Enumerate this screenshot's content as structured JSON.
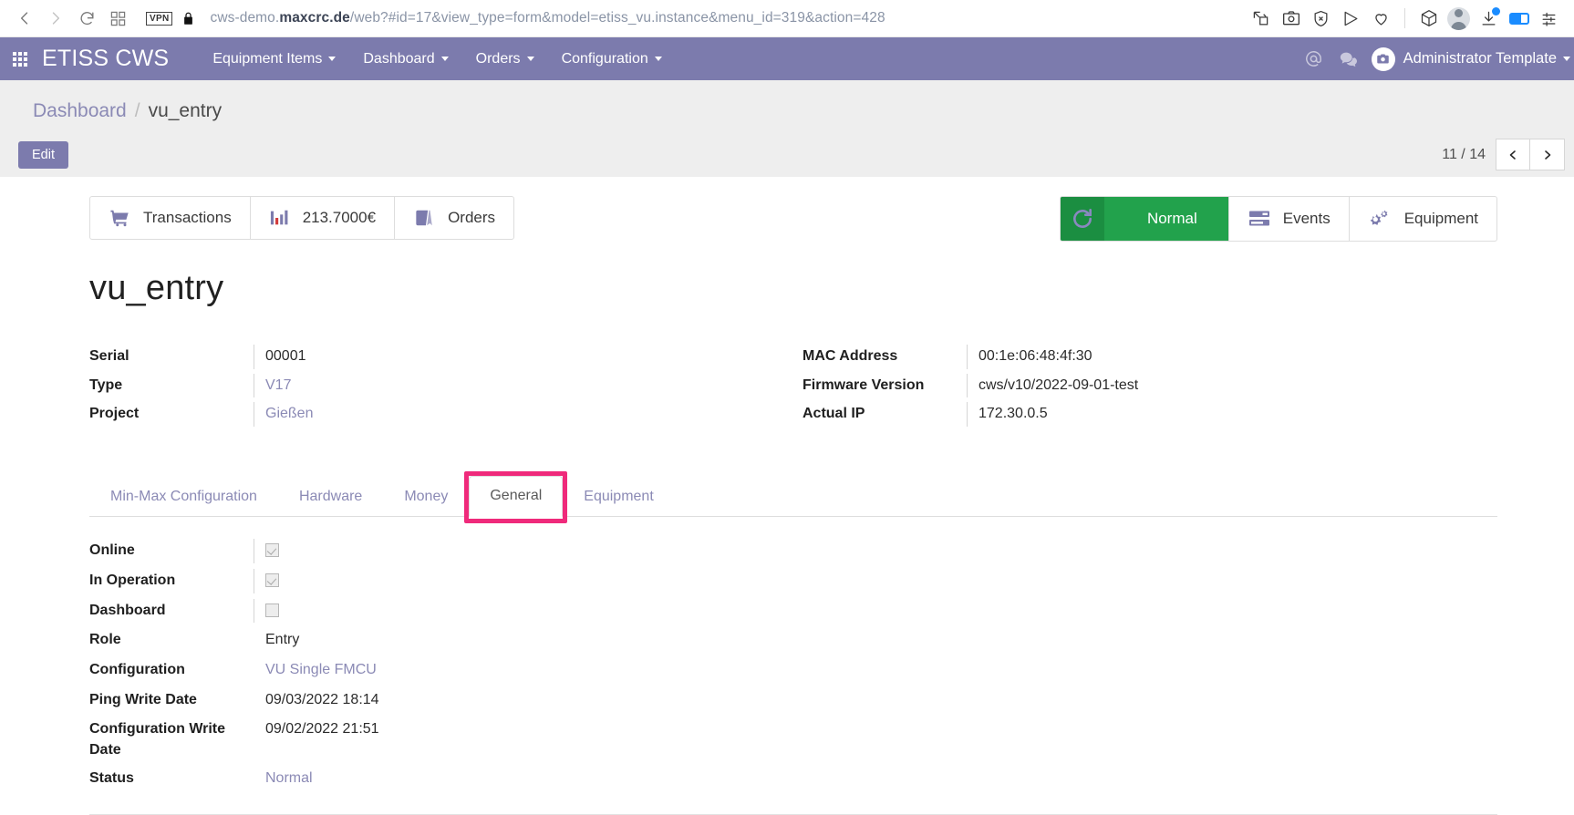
{
  "browser": {
    "back_icon": "back-arrow-icon",
    "forward_icon": "forward-arrow-icon",
    "reload_icon": "reload-icon",
    "tabs_icon": "tab-overview-icon",
    "vpn_badge": "VPN",
    "lock_icon": "lock-icon",
    "url_prefix": "cws-demo.",
    "url_domain": "maxcrc.de",
    "url_suffix": "/web?#id=17&view_type=form&model=etiss_vu.instance&menu_id=319&action=428",
    "url_full": "cws-demo.maxcrc.de/web?#id=17&view_type=form&model=etiss_vu.instance&menu_id=319&action=428",
    "toolbar_icons": [
      "pin-edit-icon",
      "camera-icon",
      "shield-block-icon",
      "send-icon",
      "heart-icon",
      "cube-icon",
      "profile-avatar-icon",
      "download-icon",
      "sidebar-toggle-icon",
      "settings-sliders-icon"
    ]
  },
  "navbar": {
    "apps_icon": "apps-grid-icon",
    "brand": "ETISS CWS",
    "menus": [
      {
        "label": "Equipment Items"
      },
      {
        "label": "Dashboard"
      },
      {
        "label": "Orders"
      },
      {
        "label": "Configuration"
      }
    ],
    "mention_icon": "at-mention-icon",
    "chat_icon": "chat-bubble-icon",
    "user_avatar_icon": "user-camera-avatar-icon",
    "user_name": "Administrator Template"
  },
  "control": {
    "breadcrumb": {
      "parent": "Dashboard",
      "separator": "/",
      "current": "vu_entry"
    },
    "edit_label": "Edit",
    "pager_count": "11 / 14",
    "prev_icon": "chevron-left-icon",
    "next_icon": "chevron-right-icon"
  },
  "stat_buttons_left": [
    {
      "label": "Transactions",
      "icon": "shopping-cart-icon"
    },
    {
      "label": "213.7000€",
      "icon": "bar-chart-icon"
    },
    {
      "label": "Orders",
      "icon": "book-orders-icon"
    }
  ],
  "stat_buttons_right": [
    {
      "label": "Normal",
      "icon": "refresh-status-icon",
      "color": "#22a24c"
    },
    {
      "label": "Events",
      "icon": "server-list-icon"
    },
    {
      "label": "Equipment",
      "icon": "gears-icon"
    }
  ],
  "record": {
    "title": "vu_entry",
    "left_fields": [
      {
        "label": "Serial",
        "value": "00001",
        "link": false
      },
      {
        "label": "Type",
        "value": "V17",
        "link": true
      },
      {
        "label": "Project",
        "value": "Gießen",
        "link": true
      }
    ],
    "right_fields": [
      {
        "label": "MAC Address",
        "value": "00:1e:06:48:4f:30",
        "link": false
      },
      {
        "label": "Firmware Version",
        "value": "cws/v10/2022-09-01-test",
        "link": false
      },
      {
        "label": "Actual IP",
        "value": "172.30.0.5",
        "link": false
      }
    ]
  },
  "tabs": [
    {
      "label": "Min-Max Configuration",
      "active": false
    },
    {
      "label": "Hardware",
      "active": false
    },
    {
      "label": "Money",
      "active": false
    },
    {
      "label": "General",
      "active": true
    },
    {
      "label": "Equipment",
      "active": false
    }
  ],
  "highlight_color": "#ef2a7b",
  "general_tab": {
    "fields": [
      {
        "label": "Online",
        "type": "checkbox",
        "checked": true
      },
      {
        "label": "In Operation",
        "type": "checkbox",
        "checked": true
      },
      {
        "label": "Dashboard",
        "type": "checkbox",
        "checked": false
      },
      {
        "label": "Role",
        "type": "text",
        "value": "Entry",
        "link": false
      },
      {
        "label": "Configuration",
        "type": "text",
        "value": "VU Single FMCU",
        "link": true
      },
      {
        "label": "Ping Write Date",
        "type": "text",
        "value": "09/03/2022 18:14",
        "link": false
      },
      {
        "label": "Configuration Write Date",
        "type": "text",
        "value": "09/02/2022 21:51",
        "link": false
      },
      {
        "label": "Status",
        "type": "text",
        "value": "Normal",
        "link": true
      }
    ]
  },
  "theme": {
    "brand_purple": "#7c7bad",
    "link_purple": "#8b8ab5",
    "status_green": "#22a24c"
  }
}
